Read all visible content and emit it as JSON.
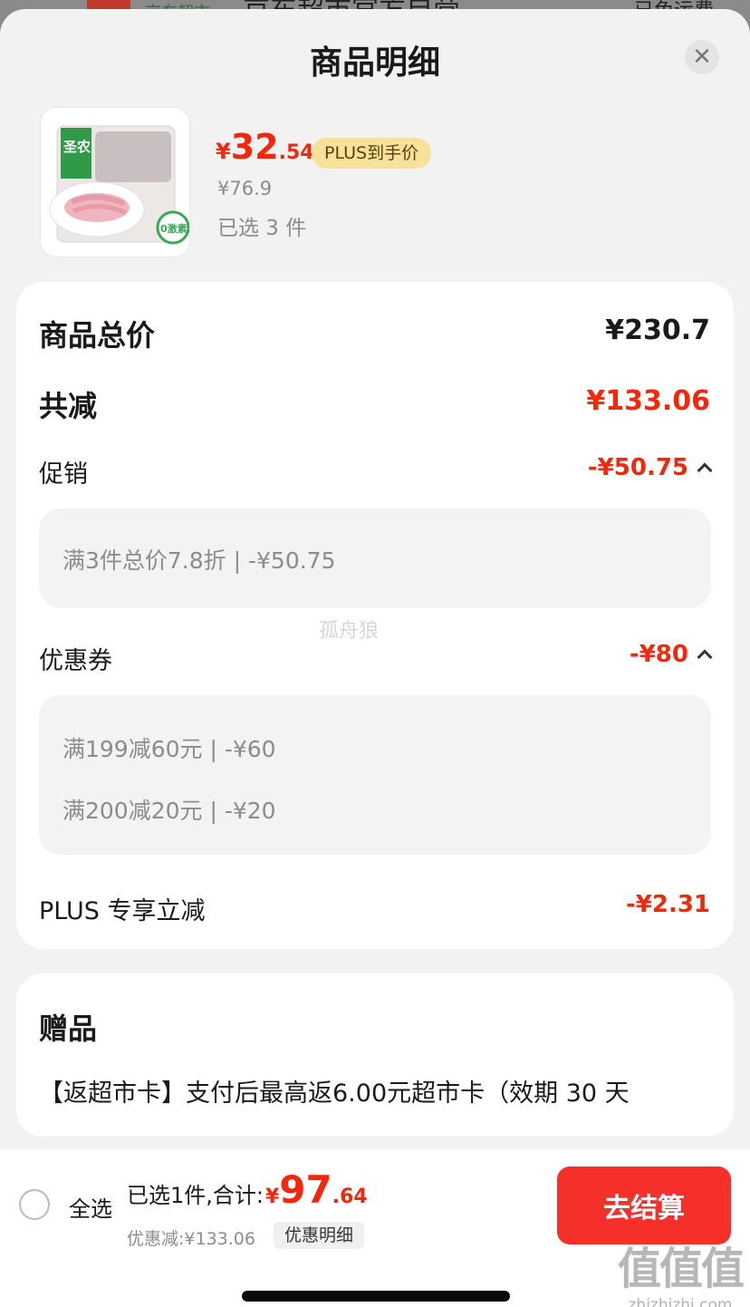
{
  "background": {
    "store_subtitle": "京东超市",
    "store_title": "京东超市官方自营",
    "shipping_note": "已免运费"
  },
  "sheet": {
    "title": "商品明细",
    "close_icon": "close-icon"
  },
  "product": {
    "price_symbol": "¥",
    "price_int": "32",
    "price_dec": ".54",
    "plus_badge": "PLUS到手价",
    "original_price": "¥76.9",
    "selected_count": "已选 3 件",
    "brand_text": "圣农",
    "badge_text": "0激素"
  },
  "breakdown": {
    "total_label": "商品总价",
    "total_value": "¥230.7",
    "saving_label": "共减",
    "saving_value": "¥133.06",
    "promo_label": "促销",
    "promo_value": "-¥50.75",
    "promo_detail": "满3件总价7.8折 | -¥50.75",
    "coupon_label": "优惠券",
    "coupon_value": "-¥80",
    "coupon_details": [
      "满199减60元 | -¥60",
      "满200减20元 | -¥20"
    ],
    "plus_label": "PLUS 专享立减",
    "plus_value": "-¥2.31"
  },
  "gift": {
    "title": "赠品",
    "text": "【返超市卡】支付后最高返6.00元超市卡（效期 30 天"
  },
  "footer": {
    "select_all": "全选",
    "sum_prefix": "已选1件,合计:",
    "sum_symbol": "¥",
    "sum_int": "97",
    "sum_dec": ".64",
    "discount_line": "优惠减:¥133.06",
    "discount_detail": "优惠明细",
    "checkout": "去结算"
  },
  "watermarks": {
    "middle": "孤舟狼",
    "logo": "值值值",
    "url": "zhizhizhi.com"
  },
  "colors": {
    "accent_red": "#f2270c",
    "checkout_red": "#f5302b",
    "plus_gold": "#f7e29a"
  }
}
